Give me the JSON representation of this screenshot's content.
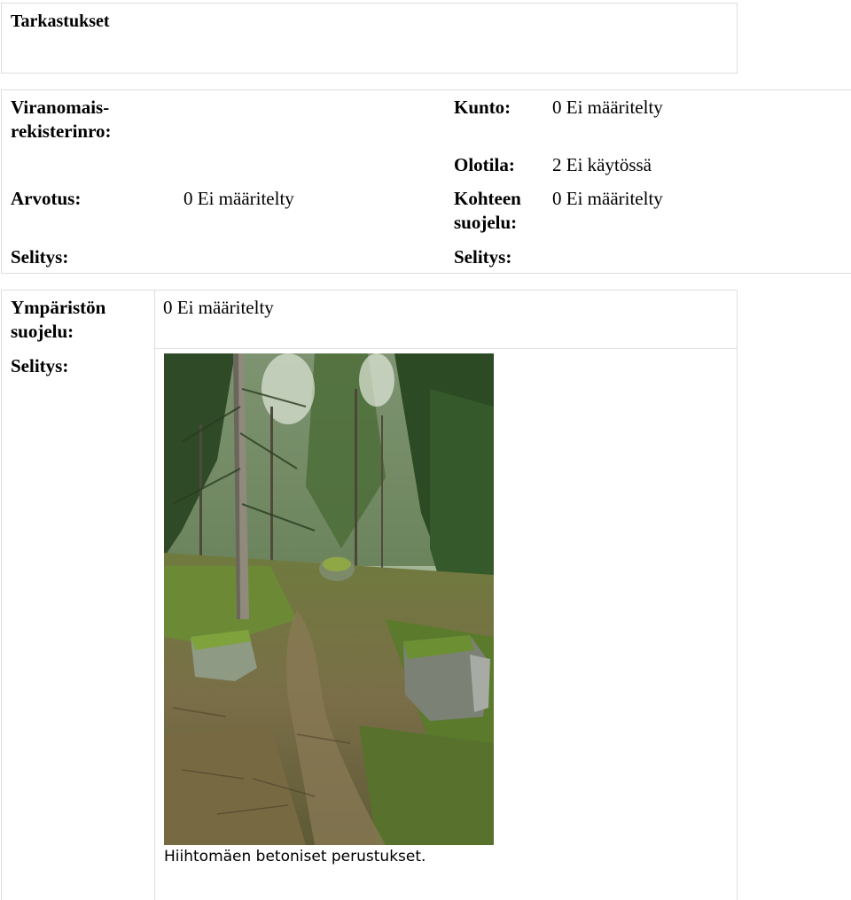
{
  "section": {
    "title": "Tarkastukset"
  },
  "status": {
    "registry_label": "Viranomais-\nrekisterinro:",
    "condition_label": "Kunto:",
    "condition_value": "0 Ei määritelty",
    "state_label": "Olotila:",
    "state_value": "2 Ei käytössä",
    "valuation_label": "Arvotus:",
    "valuation_value": "0 Ei määritelty",
    "protection_label": "Kohteen\nsuojelu:",
    "protection_value": "0 Ei määritelty",
    "explanation_left_label": "Selitys:",
    "explanation_right_label": "Selitys:"
  },
  "environment": {
    "protection_label": "Ympäristön\nsuojelu:",
    "protection_value": "0 Ei määritelty",
    "explanation_label": "Selitys:",
    "photo_caption": "Hiihtomäen betoniset perustukset.",
    "photo_subject": "forest-path-with-mossy-concrete-foundations"
  },
  "colors": {
    "border": "#dedede",
    "text": "#000000"
  }
}
